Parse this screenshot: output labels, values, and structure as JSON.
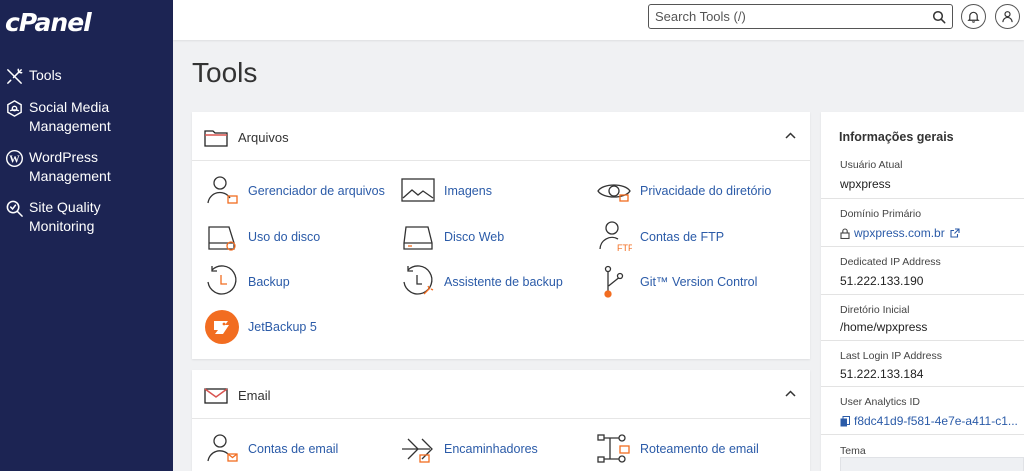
{
  "brand": {
    "logo_text": "cPanel"
  },
  "sidebar": {
    "items": [
      {
        "label": "Tools",
        "icon": "tools-icon"
      },
      {
        "label": "Social Media Management",
        "icon": "social-media-icon"
      },
      {
        "label": "WordPress Management",
        "icon": "wordpress-icon"
      },
      {
        "label": "Site Quality Monitoring",
        "icon": "site-quality-icon"
      }
    ]
  },
  "header": {
    "search_placeholder": "Search Tools (/)"
  },
  "page": {
    "title": "Tools"
  },
  "sections": {
    "arquivos": {
      "title": "Arquivos",
      "tools": [
        {
          "label": "Gerenciador de arquivos",
          "icon": "file-manager-icon"
        },
        {
          "label": "Imagens",
          "icon": "images-icon"
        },
        {
          "label": "Privacidade do diretório",
          "icon": "directory-privacy-icon"
        },
        {
          "label": "Uso do disco",
          "icon": "disk-usage-icon"
        },
        {
          "label": "Disco Web",
          "icon": "web-disk-icon"
        },
        {
          "label": "Contas de FTP",
          "icon": "ftp-accounts-icon"
        },
        {
          "label": "Backup",
          "icon": "backup-icon"
        },
        {
          "label": "Assistente de backup",
          "icon": "backup-wizard-icon"
        },
        {
          "label": "Git™ Version Control",
          "icon": "git-icon"
        },
        {
          "label": "JetBackup 5",
          "icon": "jetbackup-icon"
        }
      ]
    },
    "email": {
      "title": "Email",
      "tools": [
        {
          "label": "Contas de email",
          "icon": "email-accounts-icon"
        },
        {
          "label": "Encaminhadores",
          "icon": "forwarders-icon"
        },
        {
          "label": "Roteamento de email",
          "icon": "email-routing-icon"
        }
      ]
    }
  },
  "info": {
    "title": "Informações gerais",
    "rows": [
      {
        "label": "Usuário Atual",
        "value": "wpxpress"
      },
      {
        "label": "Domínio Primário",
        "value": "wpxpress.com.br"
      },
      {
        "label": "Dedicated IP Address",
        "value": "51.222.133.190"
      },
      {
        "label": "Diretório Inicial",
        "value": "/home/wpxpress"
      },
      {
        "label": "Last Login IP Address",
        "value": "51.222.133.184"
      },
      {
        "label": "User Analytics ID",
        "value": "f8dc41d9-f581-4e7e-a411-c1..."
      },
      {
        "label": "Tema",
        "value": ""
      }
    ]
  },
  "colors": {
    "sidebar_bg": "#1c2453",
    "link": "#2b5ba8",
    "accent_orange": "#f26d21"
  }
}
